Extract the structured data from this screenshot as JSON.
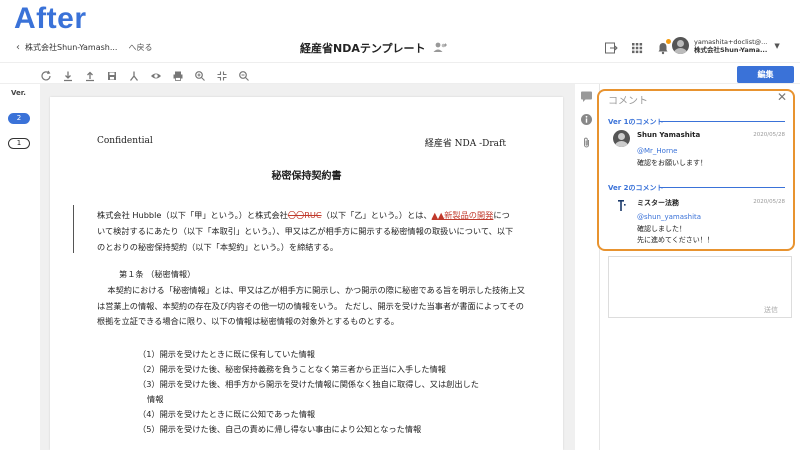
{
  "overlay": {
    "label": "After"
  },
  "header": {
    "back_org": "株式会社Shun-Yamash...",
    "back_link": "へ戻る",
    "doc_title": "経産省NDAテンプレート",
    "user_email": "yamashita+doclist@...",
    "user_org": "株式会社Shun-Yama..."
  },
  "toolbar": {
    "edit_label": "編集"
  },
  "versions": {
    "label": "Ver.",
    "items": [
      "2",
      "1"
    ]
  },
  "document": {
    "confidential": "Confidential",
    "draft": "経産省 NDA -Draft",
    "title": "秘密保持契約書",
    "para_a": "株式会社 Hubble（以下「甲」という。）と株式会社",
    "para_del": "〇〇RUC",
    "para_b": "（以下「乙」という。）とは、",
    "para_ins": "▲▲新製品の開発",
    "para_c": "について検討するにあたり（以下「本取引」という。）、甲又は乙が相手方に開示する秘密情報の取扱いについて、以下のとおりの秘密保持契約（以下「本契約」という。）を締結する。",
    "article1": "第１条 （秘密情報）",
    "article1_body": "本契約における「秘密情報」とは、甲又は乙が相手方に開示し、かつ開示の際に秘密である旨を明示した技術上又は営業上の情報、本契約の存在及び内容その他一切の情報をいう。 ただし、開示を受けた当事者が書面によってその根拠を立証できる場合に限り、以下の情報は秘密情報の対象外とするものとする。",
    "items": [
      "（1）開示を受けたときに既に保有していた情報",
      "（2）開示を受けた後、秘密保持義務を負うことなく第三者から正当に入手した情報",
      "（3）開示を受けた後、相手方から開示を受けた情報に関係なく独自に取得し、又は創出した",
      "情報",
      "（4）開示を受けたときに既に公知であった情報",
      "（5）開示を受けた後、自己の責めに帰し得ない事由により公知となった情報"
    ]
  },
  "comments": {
    "title": "コメント",
    "v1_label": "Ver 1のコメント",
    "v2_label": "Ver 2のコメント",
    "c1": {
      "name": "Shun Yamashita",
      "date": "2020/05/28",
      "mention": "@Mr_Horne",
      "text": "確認をお願いします！"
    },
    "c2": {
      "name": "ミスター法務",
      "date": "2020/05/28",
      "mention": "@shun_yamashita",
      "text1": "確認しました！",
      "text2": "先に進めてください！！"
    },
    "send_label": "送信"
  }
}
